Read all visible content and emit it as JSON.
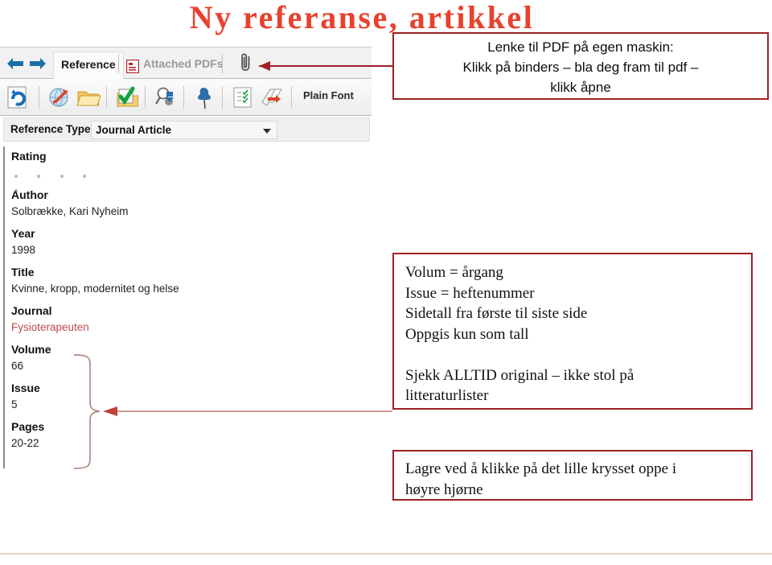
{
  "slide": {
    "title": "Ny referanse, artikkel",
    "title_color": "#e8412e",
    "callout_border_color": "#9e2026",
    "bottom_rule_color": "#e6cfc2"
  },
  "app": {
    "tabs": [
      {
        "label": "Reference",
        "active": true
      },
      {
        "label": "Attached PDFs",
        "active": false
      }
    ],
    "nav": {
      "back_icon": "arrow-left-icon",
      "forward_icon": "arrow-right-icon"
    },
    "attachment_icon": "paperclip-icon",
    "toolbar": {
      "plain_font_label": "Plain Font",
      "buttons": [
        "sync-document-icon",
        "globe-link-icon",
        "open-folder-icon",
        "folder-check-icon",
        "find-full-text-icon",
        "pushpin-icon",
        "checklist-icon",
        "export-book-icon"
      ]
    },
    "reference_type": {
      "label": "Reference Type:",
      "value": "Journal Article",
      "caret_icon": "chevron-down-icon"
    },
    "fields": [
      {
        "label": "Rating",
        "value": "",
        "kind": "stars",
        "stars": 5
      },
      {
        "label": "Author",
        "value": "Solbrække, Kari Nyheim",
        "kind": "text"
      },
      {
        "label": "Year",
        "value": "1998",
        "kind": "text"
      },
      {
        "label": "Title",
        "value": "Kvinne, kropp, modernitet og helse",
        "kind": "text"
      },
      {
        "label": "Journal",
        "value": "Fysioterapeuten",
        "kind": "term"
      },
      {
        "label": "Volume",
        "value": "66",
        "kind": "text"
      },
      {
        "label": "Issue",
        "value": "5",
        "kind": "text"
      },
      {
        "label": "Pages",
        "value": "20-22",
        "kind": "text"
      }
    ]
  },
  "callouts": {
    "pdf": {
      "line1": "Lenke til PDF på egen maskin:",
      "line2": "Klikk på binders – bla deg fram til pdf –",
      "line3": "klikk åpne"
    },
    "volume": {
      "line1": "Volum = årgang",
      "line2": "Issue = heftenummer",
      "line3": "Sidetall fra første til siste side",
      "line4": "Oppgis kun som tall",
      "line5": "Sjekk ALLTID original – ikke stol på",
      "line6": "litteraturlister"
    },
    "save": {
      "line1": "Lagre ved å klikke på det lille krysset oppe i",
      "line2": "høyre hjørne"
    }
  }
}
